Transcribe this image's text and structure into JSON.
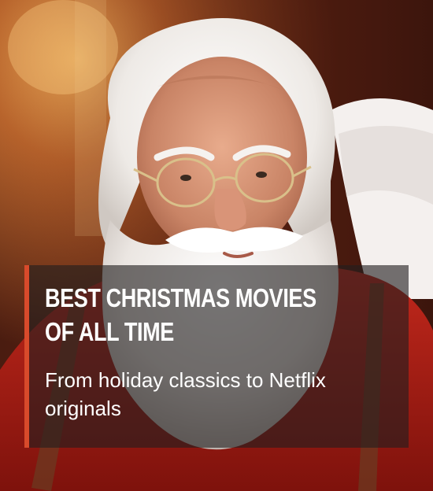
{
  "article_card": {
    "title": "BEST CHRISTMAS MOVIES OF ALL TIME",
    "subtitle": "From holiday classics to Netflix originals",
    "accent_color": "#d84a2b",
    "overlay_color": "#221e1e"
  },
  "hero_image": {
    "subject": "santa-claus-photo"
  }
}
